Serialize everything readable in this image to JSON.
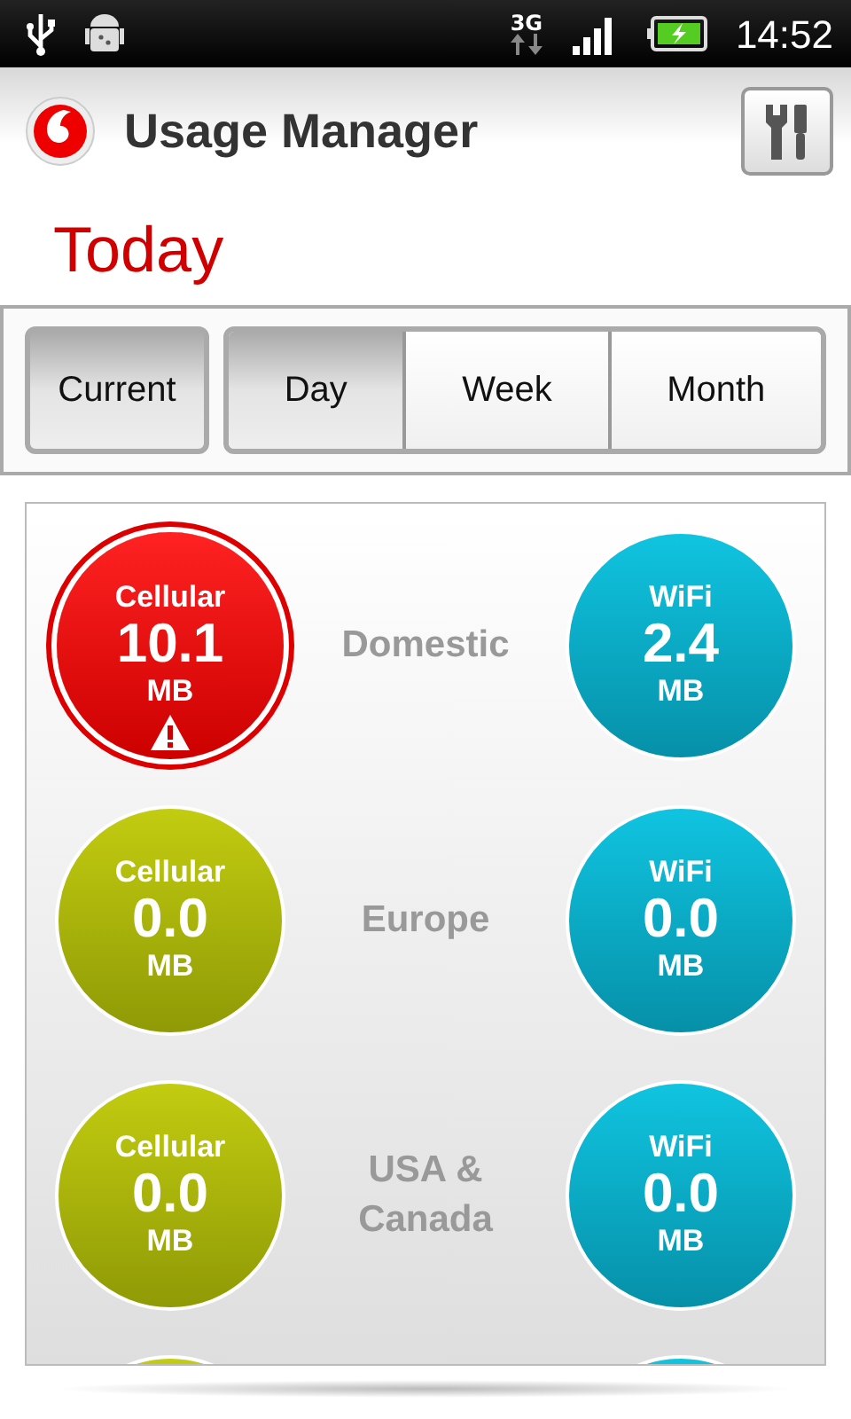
{
  "status_bar": {
    "network": "3G",
    "time": "14:52"
  },
  "app_bar": {
    "title": "Usage Manager"
  },
  "period_title": "Today",
  "current_button": {
    "label": "Current",
    "selected": true
  },
  "periods": [
    {
      "label": "Day",
      "selected": true
    },
    {
      "label": "Week",
      "selected": false
    },
    {
      "label": "Month",
      "selected": false
    }
  ],
  "regions": [
    {
      "name": "Domestic",
      "cellular": {
        "label": "Cellular",
        "value": "10.1",
        "unit": "MB",
        "warning": true
      },
      "wifi": {
        "label": "WiFi",
        "value": "2.4",
        "unit": "MB"
      }
    },
    {
      "name": "Europe",
      "cellular": {
        "label": "Cellular",
        "value": "0.0",
        "unit": "MB",
        "warning": false
      },
      "wifi": {
        "label": "WiFi",
        "value": "0.0",
        "unit": "MB"
      }
    },
    {
      "name": "USA & Canada",
      "cellular": {
        "label": "Cellular",
        "value": "0.0",
        "unit": "MB",
        "warning": false
      },
      "wifi": {
        "label": "WiFi",
        "value": "0.0",
        "unit": "MB"
      }
    },
    {
      "cellular": {
        "warning": false
      }
    }
  ]
}
